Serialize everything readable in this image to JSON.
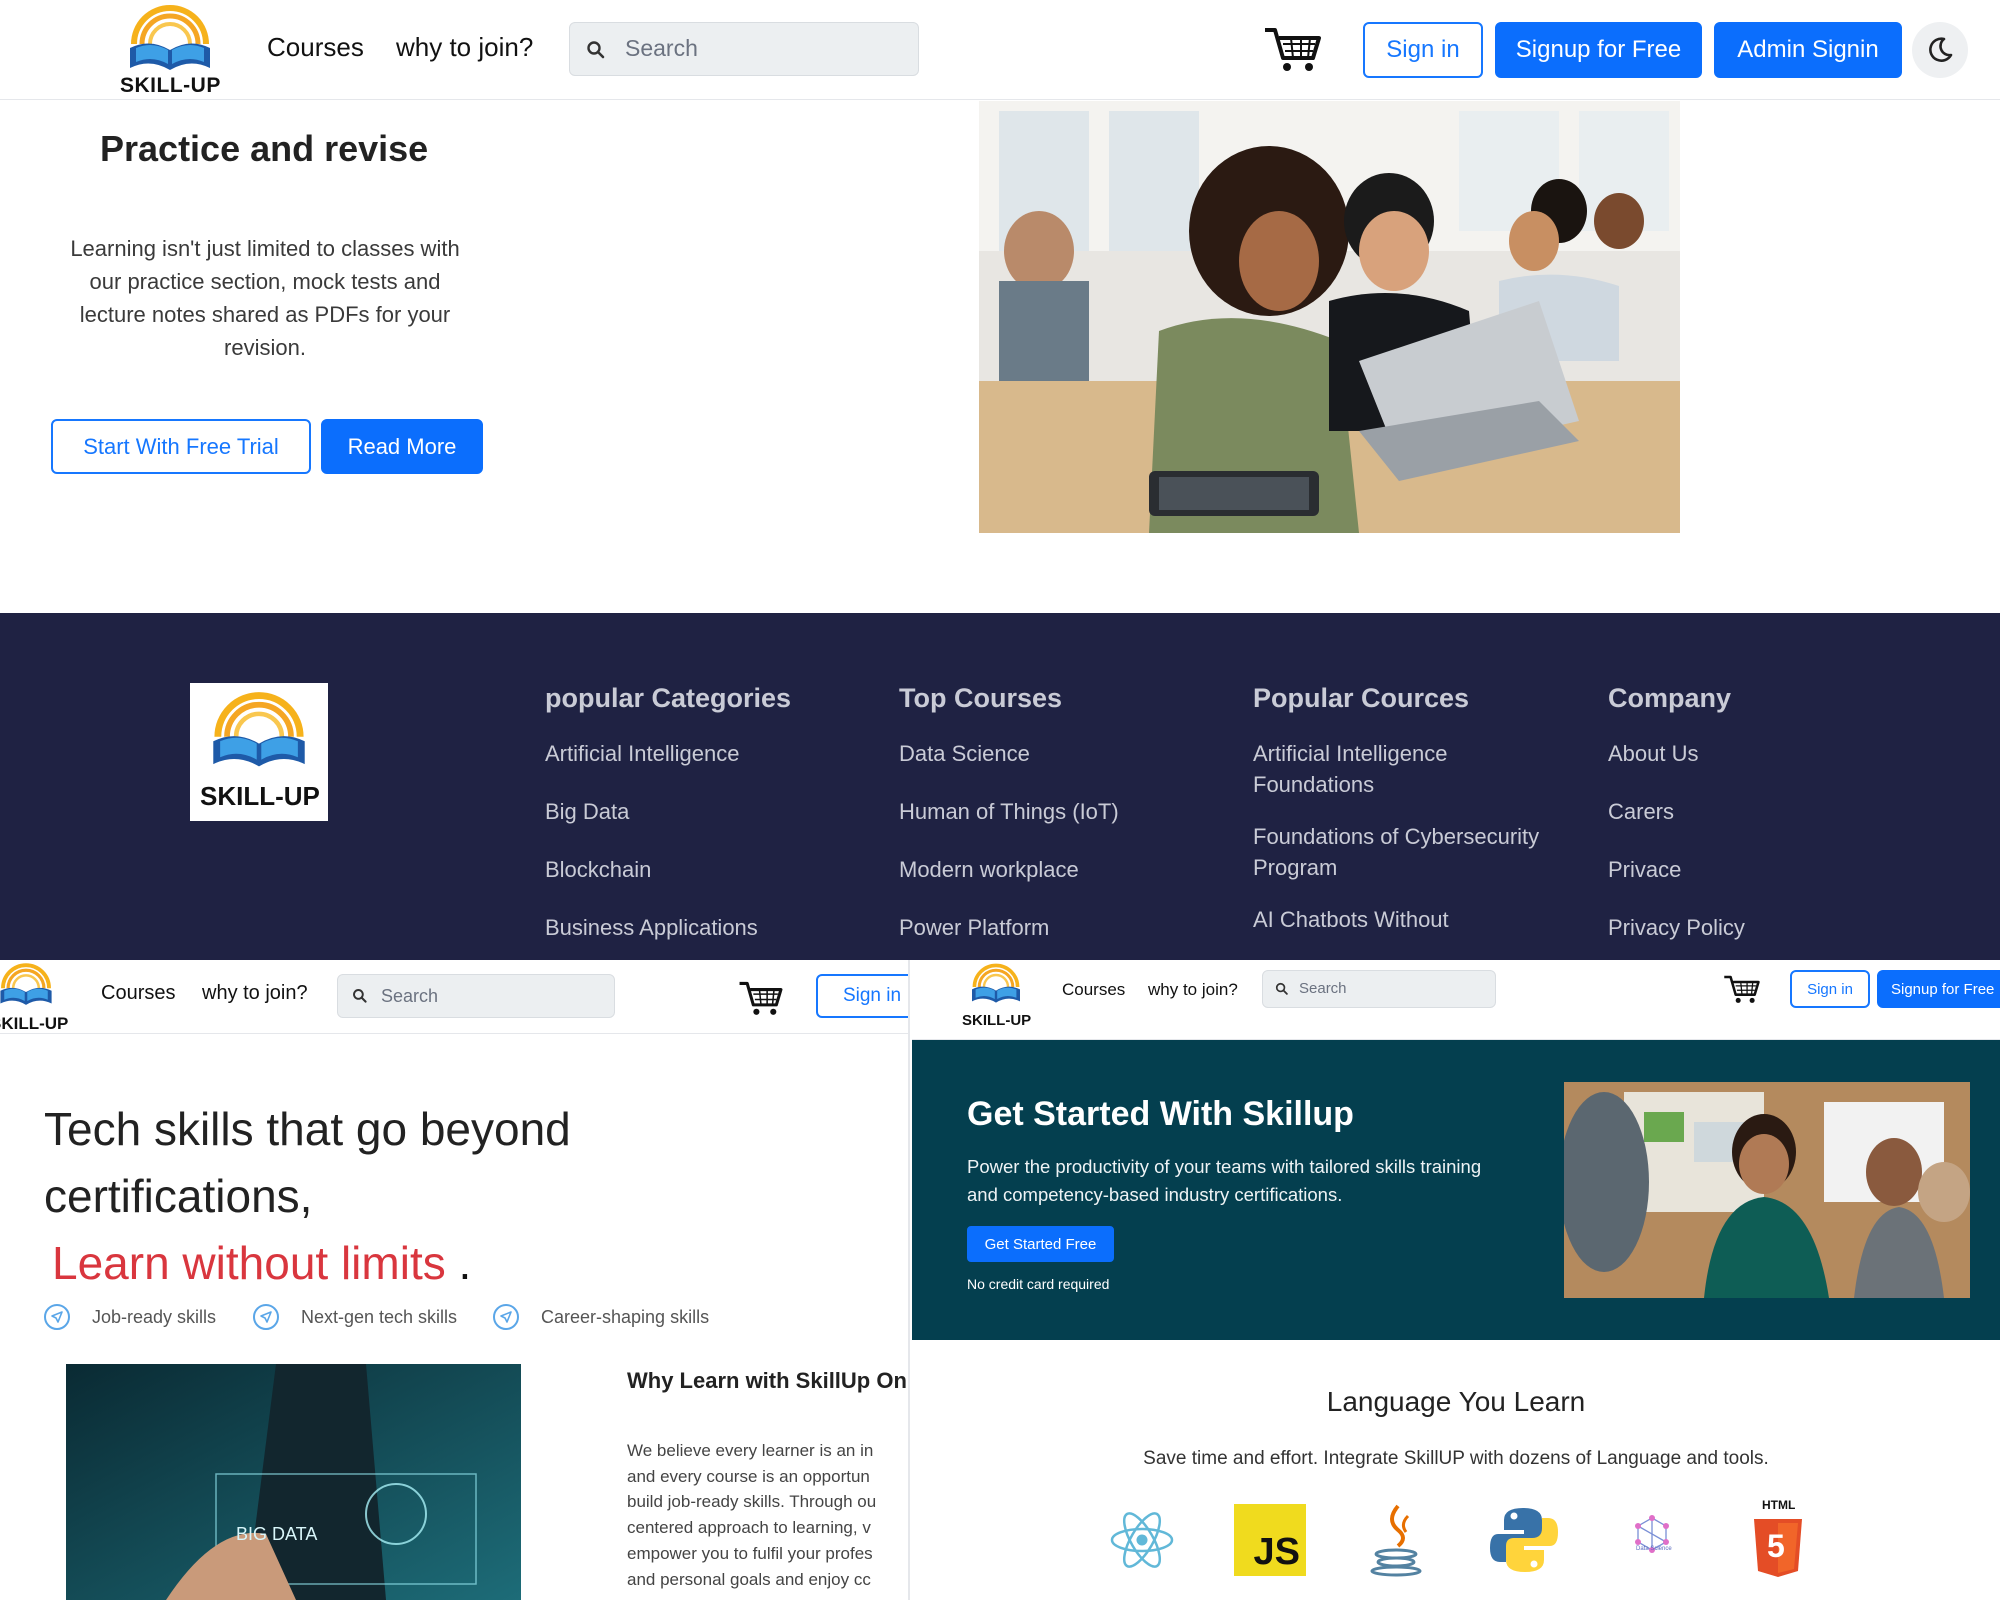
{
  "brand": {
    "logo_text": "SKILL-UP"
  },
  "nav": {
    "courses": "Courses",
    "why_join": "why to join?",
    "search_placeholder": "Search",
    "sign_in": "Sign in",
    "signup_free": "Signup for Free",
    "admin_signin": "Admin Signin"
  },
  "hero": {
    "title": "Practice and revise",
    "body": "Learning isn't just limited to classes with our practice section, mock tests and lecture notes shared as PDFs for your revision.",
    "trial_button": "Start With Free Trial",
    "read_more_button": "Read More"
  },
  "footer": {
    "columns": [
      {
        "title": "popular Categories",
        "items": [
          "Artificial Intelligence",
          "Big Data",
          "Blockchain",
          "Business Applications"
        ]
      },
      {
        "title": "Top Courses",
        "items": [
          "Data Science",
          "Human of Things (IoT)",
          "Modern workplace",
          "Power Platform"
        ]
      },
      {
        "title": "Popular Cources",
        "items": [
          "Artificial Intelligence Foundations",
          "Foundations of Cybersecurity Program",
          "AI Chatbots Without"
        ]
      },
      {
        "title": "Company",
        "items": [
          "About Us",
          "Carers",
          "Privace",
          "Privacy Policy"
        ]
      }
    ]
  },
  "landing": {
    "headline_line1": "Tech skills that go beyond",
    "headline_line2": "certifications,",
    "headline_highlight": "Learn without limits",
    "headline_end": ".",
    "features": [
      "Job-ready skills",
      "Next-gen tech skills",
      "Career-shaping skills"
    ],
    "image_label": "BIG DATA",
    "why_title": "Why Learn with SkillUp Onl",
    "why_lines": [
      "We believe every learner is an in",
      "and every course is an opportun",
      "build job-ready skills. Through ou",
      "centered approach to learning, v",
      "empower you to fulfil your profes",
      "and personal goals and enjoy cc"
    ]
  },
  "get_started": {
    "title": "Get Started With Skillup",
    "body": "Power the productivity of your teams with tailored skills training and competency-based industry certifications.",
    "button": "Get Started Free",
    "note": "No credit card required"
  },
  "languages": {
    "title": "Language You Learn",
    "subtitle": "Save time and effort. Integrate SkillUP with dozens of Language and tools.",
    "icons": [
      "react-icon",
      "javascript-icon",
      "java-icon",
      "python-icon",
      "data-science-icon",
      "html5-icon"
    ],
    "js_text": "JS",
    "html_text": "HTML",
    "html_num": "5",
    "ds_text": "Data Science"
  },
  "colors": {
    "primary": "#0b6efd",
    "footer_bg": "#1f2243",
    "banner_bg": "#043f4f",
    "highlight_red": "#d9363e"
  }
}
